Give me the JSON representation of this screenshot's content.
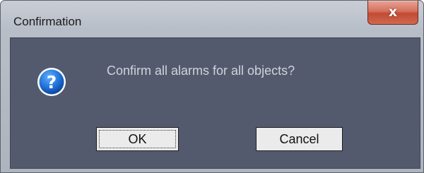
{
  "window": {
    "title": "Confirmation",
    "close_glyph": "x",
    "close_icon": "close-icon"
  },
  "dialog": {
    "icon": "question-icon",
    "message": "Confirm all alarms for all objects?",
    "ok_label": "OK",
    "cancel_label": "Cancel"
  },
  "colors": {
    "client_background": "#545a6e",
    "icon_blue": "#1f6fd6",
    "close_red": "#c24a33"
  }
}
